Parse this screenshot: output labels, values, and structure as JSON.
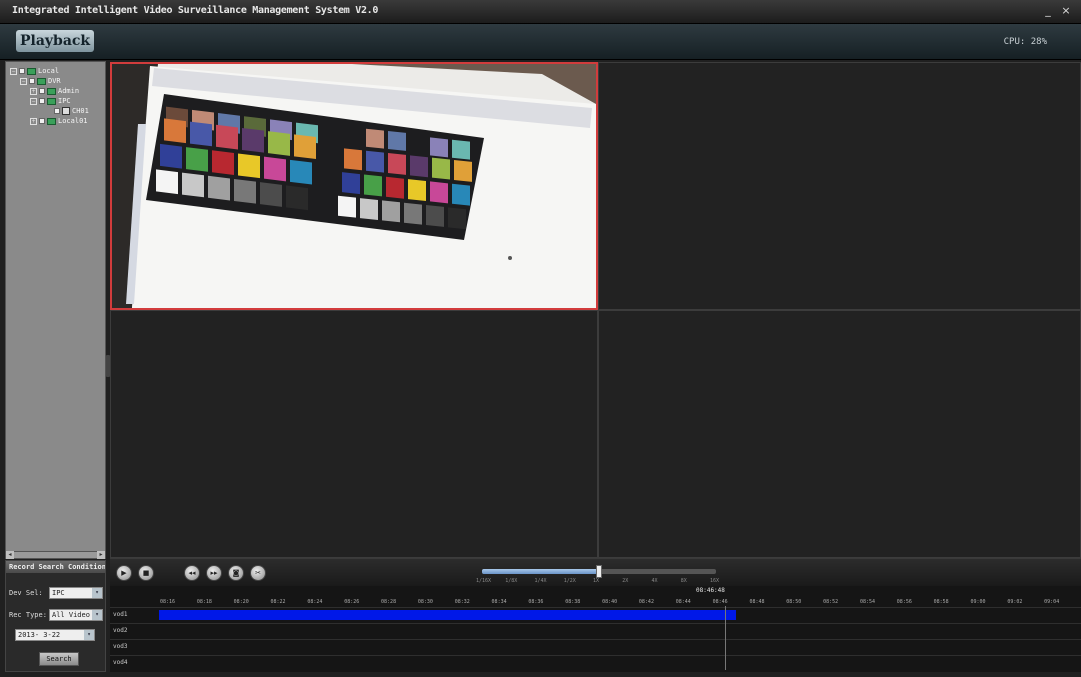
{
  "window": {
    "title": "Integrated Intelligent Video Surveillance Management System V2.0",
    "min_glyph": "_",
    "close_glyph": "×"
  },
  "header": {
    "logo": "Playback",
    "status": "CPU: 28%"
  },
  "sidebar": {
    "tree": [
      {
        "label": "Local",
        "kind": "group"
      },
      {
        "label": "DVR",
        "kind": "group"
      },
      {
        "label": "Admin",
        "kind": "group"
      },
      {
        "label": "IPC",
        "kind": "group"
      },
      {
        "label": "CH01",
        "kind": "camera"
      },
      {
        "label": "Local01",
        "kind": "group"
      }
    ],
    "scroll_left": "◂",
    "scroll_right": "▸"
  },
  "search_panel": {
    "heading": "Record Search Condition",
    "rows": [
      {
        "label": "Dev Sel:",
        "value": "IPC"
      },
      {
        "label": "Rec Type:",
        "value": "All Video"
      },
      {
        "label": "",
        "value": "2013- 3-22"
      }
    ],
    "dropdown_glyph": "▾",
    "search_button": "Search"
  },
  "transport": {
    "buttons": [
      {
        "name": "play-button",
        "glyph": "▶"
      },
      {
        "name": "stop-button",
        "glyph": "■"
      },
      {
        "name": "slow-button",
        "glyph": "◂◂"
      },
      {
        "name": "fast-button",
        "glyph": "▸▸"
      },
      {
        "name": "snapshot-button",
        "glyph": "◙"
      },
      {
        "name": "clip-button",
        "glyph": "✂"
      }
    ],
    "speed_fraction": 0.5,
    "speed_labels": [
      "1/16X",
      "1/8X",
      "1/4X",
      "1/2X",
      "1X",
      "2X",
      "4X",
      "8X",
      "16X"
    ]
  },
  "timeline": {
    "time_readout": "08:46:48",
    "tick_labels": [
      "08:16",
      "08:18",
      "08:20",
      "08:22",
      "08:24",
      "08:26",
      "08:28",
      "08:30",
      "08:32",
      "08:34",
      "08:36",
      "08:38",
      "08:40",
      "08:42",
      "08:44",
      "08:46",
      "08:48",
      "08:50",
      "08:52",
      "08:54",
      "08:56",
      "08:58",
      "09:00",
      "09:02",
      "09:04"
    ],
    "channels": [
      "vod1",
      "vod2",
      "vod3",
      "vod4"
    ],
    "recording": {
      "channel": 0,
      "start_fraction": 0.05,
      "end_fraction": 0.645
    },
    "cursor_fraction": 0.633
  },
  "video": {
    "panes": [
      "pane-1",
      "pane-2",
      "pane-3",
      "pane-4"
    ],
    "active": "pane-1"
  },
  "colors": {
    "active_border": "#d23c3c",
    "record_bar": "#0018e8",
    "speed_fill": "#6b94c8"
  }
}
